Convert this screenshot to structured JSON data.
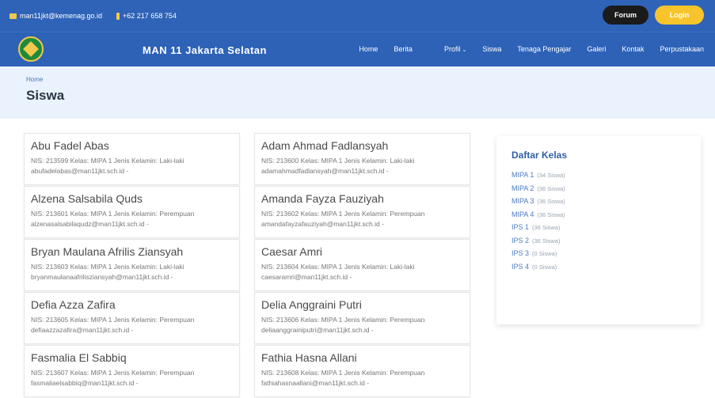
{
  "topbar": {
    "email": "man11jkt@kemenag.go.id",
    "phone": "+62 217 658 754",
    "forum_label": "Forum",
    "login_label": "Login"
  },
  "navbar": {
    "brand": "MAN 11 Jakarta Selatan",
    "menu": [
      "Home",
      "Berita",
      "Profil",
      "Siswa",
      "Tenaga Pengajar",
      "Galeri",
      "Kontak",
      "Perpustakaan"
    ]
  },
  "banner": {
    "breadcrumb": "Home",
    "title": "Siswa"
  },
  "students": [
    {
      "name": "Abu Fadel Abas",
      "info": "NIS: 213599 Kelas: MIPA 1 Jenis Kelamin: Laki-laki",
      "email": "abufadelabas@man11jkt.sch.id -"
    },
    {
      "name": "Adam Ahmad Fadlansyah",
      "info": "NIS: 213600 Kelas: MIPA 1 Jenis Kelamin: Laki-laki",
      "email": "adamahmadfadlansyah@man11jkt.sch.id -"
    },
    {
      "name": "Alzena Salsabila Quds",
      "info": "NIS: 213601 Kelas: MIPA 1 Jenis Kelamin: Perempuan",
      "email": "alzenasalsabilaqudz@man11jkt.sch.id -"
    },
    {
      "name": "Amanda Fayza Fauziyah",
      "info": "NIS: 213602 Kelas: MIPA 1 Jenis Kelamin: Perempuan",
      "email": "amandafayzafauziyah@man11jkt.sch.id -"
    },
    {
      "name": "Bryan Maulana Afrilis Ziansyah",
      "info": "NIS: 213603 Kelas: MIPA 1 Jenis Kelamin: Laki-laki",
      "email": "bryanmaulanaafrilisziansyah@man11jkt.sch.id -"
    },
    {
      "name": "Caesar Amri",
      "info": "NIS: 213604 Kelas: MIPA 1 Jenis Kelamin: Laki-laki",
      "email": "caesaramri@man11jkt.sch.id -"
    },
    {
      "name": "Defia Azza Zafira",
      "info": "NIS: 213605 Kelas: MIPA 1 Jenis Kelamin: Perempuan",
      "email": "defiaazzazafira@man11jkt.sch.id -"
    },
    {
      "name": "Delia Anggraini Putri",
      "info": "NIS: 213606 Kelas: MIPA 1 Jenis Kelamin: Perempuan",
      "email": "deliaanggrainiputri@man11jkt.sch.id -"
    },
    {
      "name": "Fasmalia El Sabbiq",
      "info": "NIS: 213607 Kelas: MIPA 1 Jenis Kelamin: Perempuan",
      "email": "fasmaliaelsabbiq@man11jkt.sch.id -"
    },
    {
      "name": "Fathia Hasna Allani",
      "info": "NIS: 213608 Kelas: MIPA 1 Jenis Kelamin: Perempuan",
      "email": "fathiahasnaallani@man11jkt.sch.id -"
    }
  ],
  "sidebar": {
    "title": "Daftar Kelas",
    "classes": [
      {
        "name": "MIPA 1",
        "count": "(34 Siswa)"
      },
      {
        "name": "MIPA 2",
        "count": "(36 Siswa)"
      },
      {
        "name": "MIPA 3",
        "count": "(36 Siswa)"
      },
      {
        "name": "MIPA 4",
        "count": "(36 Siswa)"
      },
      {
        "name": "IPS 1",
        "count": "(36 Siswa)"
      },
      {
        "name": "IPS 2",
        "count": "(36 Siswa)"
      },
      {
        "name": "IPS 3",
        "count": "(0 Siswa)"
      },
      {
        "name": "IPS 4",
        "count": "(0 Siswa)"
      }
    ]
  }
}
